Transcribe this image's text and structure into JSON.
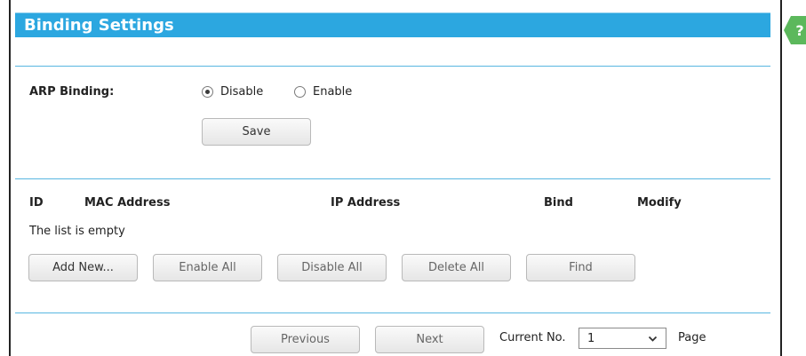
{
  "header": {
    "title": "Binding Settings"
  },
  "help": {
    "glyph": "?"
  },
  "arp": {
    "label": "ARP Binding:",
    "options": [
      {
        "label": "Disable",
        "checked": true
      },
      {
        "label": "Enable",
        "checked": false
      }
    ],
    "save_label": "Save"
  },
  "table": {
    "columns": [
      "ID",
      "MAC Address",
      "IP Address",
      "Bind",
      "Modify"
    ],
    "empty_text": "The list is empty"
  },
  "actions": {
    "add_new": "Add New...",
    "enable_all": "Enable All",
    "disable_all": "Disable All",
    "delete_all": "Delete All",
    "find": "Find"
  },
  "pager": {
    "previous": "Previous",
    "next": "Next",
    "current_label": "Current No.",
    "current_value": "1",
    "page_label": "Page"
  },
  "colors": {
    "header": "#2ca7e0",
    "divider": "#58b6e1",
    "help_badge": "#5cb85c"
  }
}
